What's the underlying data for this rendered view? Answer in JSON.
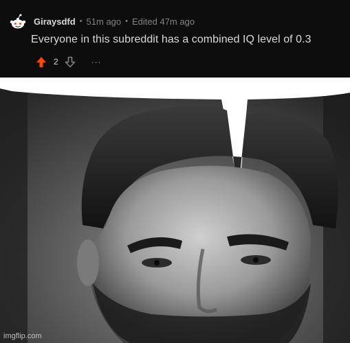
{
  "comment": {
    "username": "Giraysdfd",
    "posted_time": "51m ago",
    "edited_time": "Edited 47m ago",
    "separator": "•",
    "text": "Everyone in this subreddit has a combined IQ level of 0.3",
    "vote_count": "2",
    "more_label": "...",
    "upvote_color": "#ff4500"
  },
  "image": {
    "description_icon": "speech-bubble-meme",
    "watermark": "imgflip.com"
  }
}
